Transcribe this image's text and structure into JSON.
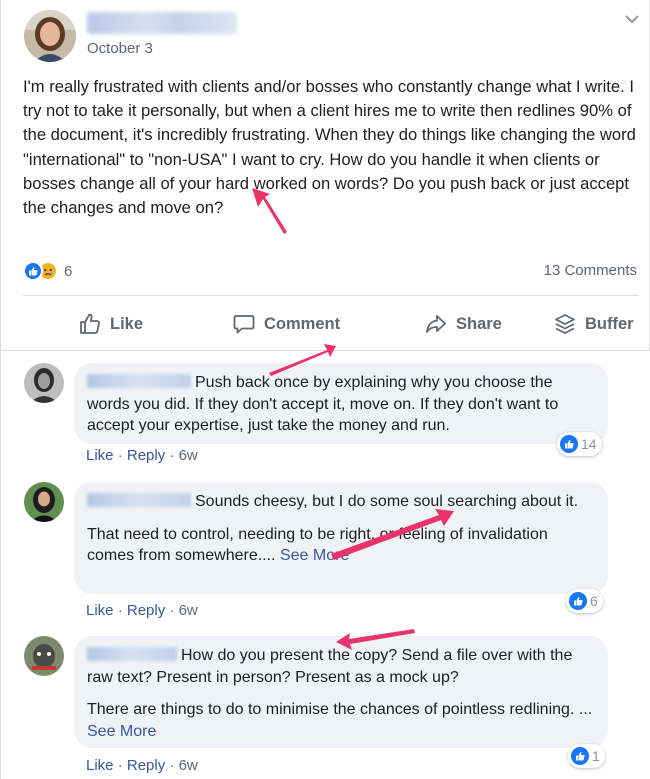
{
  "post": {
    "date": "October 3",
    "text": "I'm really frustrated with clients and/or bosses who constantly change what I write. I try not to take it personally, but when a client hires me to write then redlines 90% of the document, it's incredibly frustrating. When they do things like changing the word \"international\" to \"non-USA\" I want to cry. How do you handle it when clients or bosses change all of your hard worked on words? Do you push back or just accept the changes and move on?",
    "reaction_count": "6",
    "comments_count": "13 Comments"
  },
  "actions": {
    "like": "Like",
    "comment": "Comment",
    "share": "Share",
    "buffer": "Buffer"
  },
  "comments": [
    {
      "text": "Push back once by explaining why you choose the words you did. If they don't accept it, move on. If they don't want to accept your expertise, just take the money and run.",
      "like": "Like",
      "reply": "Reply",
      "time": "6w",
      "reactions": "14"
    },
    {
      "text": "Sounds cheesy, but I do some soul searching about it.",
      "text2": "That need to control, needing to be right, or feeling of invalidation comes from somewhere....",
      "see_more": "See More",
      "like": "Like",
      "reply": "Reply",
      "time": "6w",
      "reactions": "6"
    },
    {
      "text": "How do you present the copy? Send a file over with the raw text? Present in person? Present as a mock up?",
      "text2": "There are things to do to minimise the chances of pointless redlining. ...",
      "see_more": "See More",
      "like": "Like",
      "reply": "Reply",
      "time": "6w",
      "reactions": "1"
    }
  ],
  "colors": {
    "link": "#385898",
    "like_blue": "#1877f2",
    "arrow": "#e8336b",
    "bubble": "#f0f2f5"
  },
  "icons": [
    "chevron-down-icon",
    "like-reaction-icon",
    "sad-reaction-icon",
    "thumbs-up-icon",
    "comment-icon",
    "share-icon",
    "buffer-icon"
  ]
}
